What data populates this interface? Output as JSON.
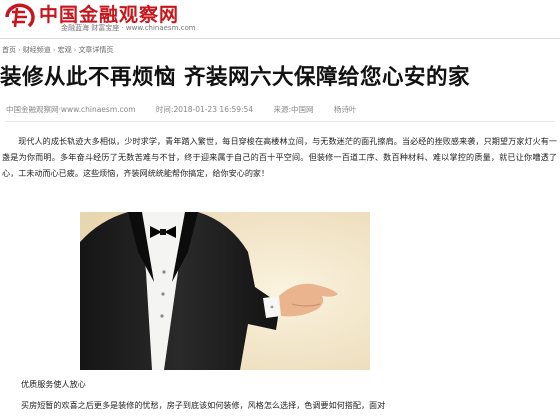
{
  "header": {
    "site_name": "中国金融观察网",
    "slogan": "金融蓝海  财富宝座 · www.chinaesm.com"
  },
  "breadcrumb": {
    "items": [
      "首页",
      "财经频道",
      "宏观",
      "文章详情页"
    ],
    "separator": "›"
  },
  "article": {
    "title": "装修从此不再烦恼  齐装网六大保障给您心安的家",
    "meta": {
      "site": "中国金融观察网·www.chinaesm.com",
      "time": "时间:2018-01-23 16:59:54",
      "source": "来源:中国网",
      "author": "杨诗叶"
    },
    "paragraph1": "现代人的成长轨迹大多相似，少时求学，青年踏入繁世，每日穿梭在高楼林立间，与无数迷茫的面孔擦肩。当必经的挫败感来袭，只期望万家灯火有一盏是为你而明。多年奋斗经历了无数苦难与不甘，终于迎来属于自己的百十平空间。但装修一百道工序、数百种材料、难以掌控的质量，就已让你嘈透了心，工未动而心已疲。这些烦恼，齐装网统统能帮你搞定，给你安心的家！",
    "image_caption": "优质服务使人放心",
    "paragraph2": "买房短暂的欢喜之后更多是装修的忧愁，房子到底该如何装修，风格怎么选择，色调要如何搭配，面对"
  },
  "colors": {
    "brand_red": "#c8161d",
    "title_text": "#111111",
    "meta_text": "#888888"
  },
  "icons": {
    "logo": "site-logo-icon"
  }
}
